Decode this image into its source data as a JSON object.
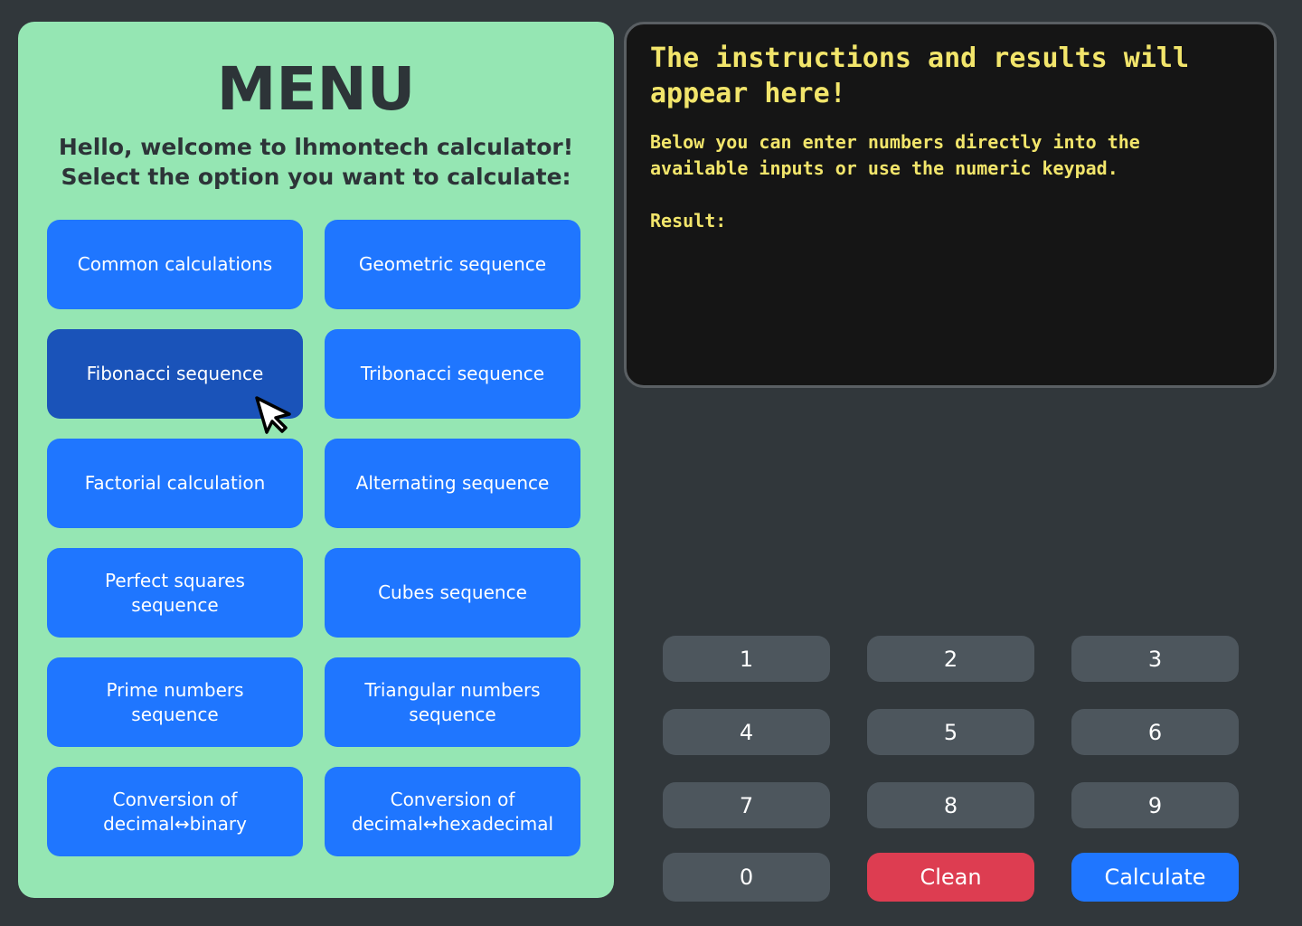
{
  "menu": {
    "title": "MENU",
    "subtitle_line1": "Hello, welcome to lhmontech calculator!",
    "subtitle_line2": "Select the option you want to calculate:",
    "buttons": [
      {
        "label": "Common calculations"
      },
      {
        "label": "Geometric sequence"
      },
      {
        "label": "Fibonacci sequence"
      },
      {
        "label": "Tribonacci sequence"
      },
      {
        "label": "Factorial calculation"
      },
      {
        "label": "Alternating sequence"
      },
      {
        "label": "Perfect squares\nsequence"
      },
      {
        "label": "Cubes sequence"
      },
      {
        "label": "Prime numbers\nsequence"
      },
      {
        "label": "Triangular numbers\nsequence"
      },
      {
        "label": "Conversion of\ndecimal↔binary"
      },
      {
        "label": "Conversion of\ndecimal↔hexadecimal"
      }
    ],
    "active_button": "Fibonacci sequence"
  },
  "screen": {
    "heading": "The instructions and results will appear here!",
    "body": "Below you can enter numbers directly into the\navailable inputs or use the numeric keypad.",
    "result_label": "Result:"
  },
  "keypad": {
    "keys": [
      "1",
      "2",
      "3",
      "4",
      "5",
      "6",
      "7",
      "8",
      "9",
      "0"
    ],
    "clean_label": "Clean",
    "calculate_label": "Calculate"
  },
  "colors": {
    "page_bg": "#31373b",
    "menu_bg": "#95e6b3",
    "menu_button": "#1f76ff",
    "menu_button_active": "#1a53b9",
    "screen_bg": "#151515",
    "screen_text": "#f2e56b",
    "key": "#4d565d",
    "clean": "#dd3d51",
    "calculate": "#1f76ff"
  }
}
